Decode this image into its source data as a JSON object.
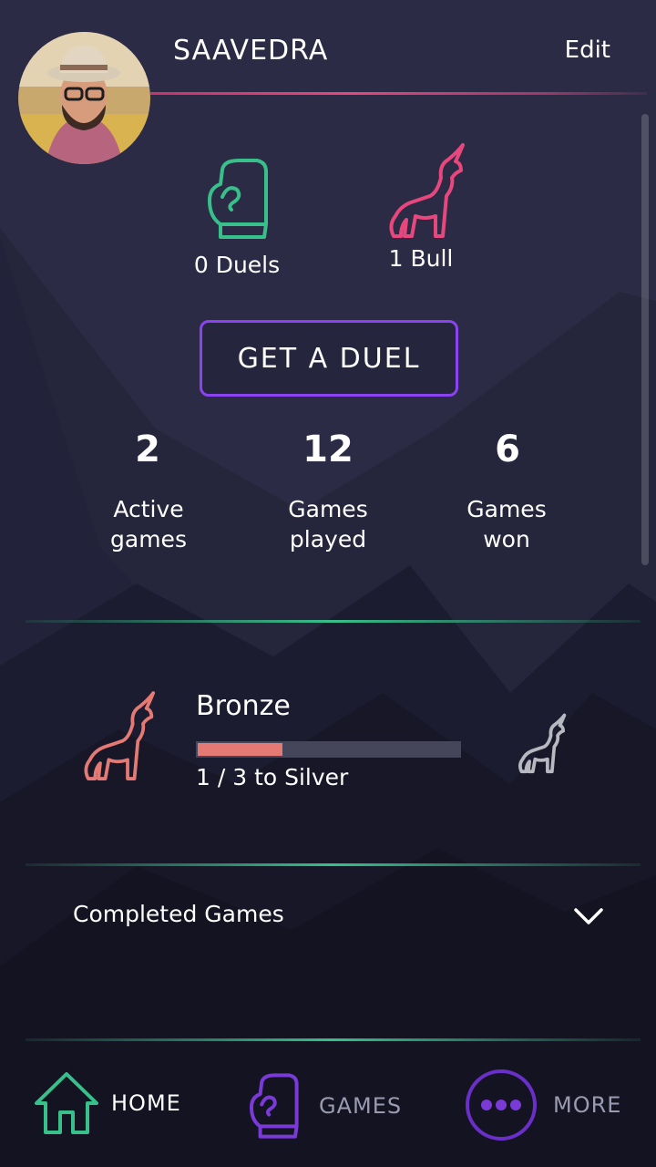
{
  "profile": {
    "username": "SAAVEDRA",
    "edit_label": "Edit"
  },
  "counters": {
    "duels_label": "0 Duels",
    "bulls_label": "1 Bull"
  },
  "action": {
    "get_duel_label": "GET A DUEL"
  },
  "stats": [
    {
      "value": "2",
      "label_line1": "Active",
      "label_line2": "games"
    },
    {
      "value": "12",
      "label_line1": "Games",
      "label_line2": "played"
    },
    {
      "value": "6",
      "label_line1": "Games",
      "label_line2": "won"
    }
  ],
  "rank": {
    "title": "Bronze",
    "progress_text": "1 / 3 to Silver",
    "progress_fraction": 0.333,
    "current_color": "#e57a74",
    "next_color": "#b8b8c0"
  },
  "completed": {
    "label": "Completed Games"
  },
  "nav": {
    "home": "HOME",
    "games": "GAMES",
    "more": "MORE"
  },
  "colors": {
    "accent_green": "#37c08a",
    "accent_pink": "#e8477d",
    "accent_purple": "#8b43f0",
    "background": "#2a2a42"
  }
}
